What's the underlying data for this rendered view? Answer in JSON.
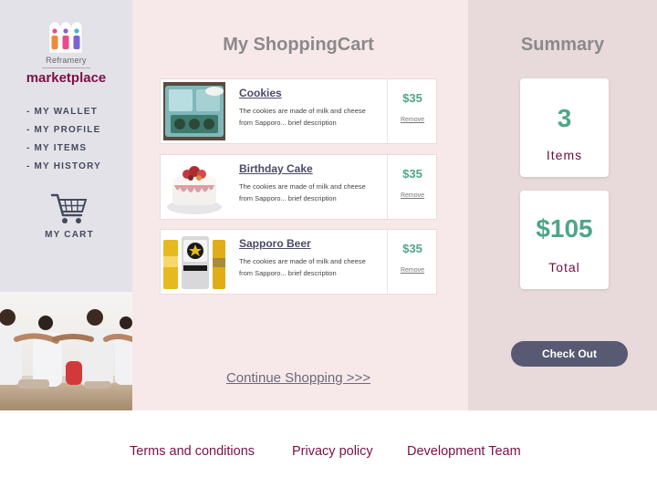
{
  "brand": {
    "sub": "Reframery",
    "name": "marketplace"
  },
  "nav": {
    "items": [
      "- MY WALLET",
      "- MY PROFILE",
      "- MY ITEMS",
      "- MY HISTORY"
    ],
    "cart_label": "MY CART"
  },
  "cart": {
    "title": "My ShoppingCart",
    "items": [
      {
        "name": "Cookies",
        "desc_line1": "The cookies are made of milk and cheese",
        "desc_line2": "from Sapporo... brief description",
        "price": "$35",
        "remove": "Remove"
      },
      {
        "name": "Birthday Cake",
        "desc_line1": "The cookies are made of milk and cheese",
        "desc_line2": "from Sapporo... brief description",
        "price": "$35",
        "remove": "Remove"
      },
      {
        "name": "Sapporo Beer",
        "desc_line1": "The cookies are made of milk and cheese",
        "desc_line2": "from Sapporo... brief description",
        "price": "$35",
        "remove": "Remove"
      }
    ],
    "continue_label": "Continue Shopping >>>"
  },
  "summary": {
    "title": "Summary",
    "item_count": "3",
    "item_count_label": "Items",
    "total": "$105",
    "total_label": "Total",
    "checkout_label": "Check Out"
  },
  "footer": {
    "links": [
      "Terms and conditions",
      "Privacy policy",
      "Development Team"
    ]
  },
  "colors": {
    "brand": "#7a1046",
    "price": "#4fa58a",
    "checkout_button": "#575a72",
    "sidebar_bg": "#e4e2e9",
    "main_bg": "#f7e9e9",
    "summary_bg": "#e8dada"
  }
}
